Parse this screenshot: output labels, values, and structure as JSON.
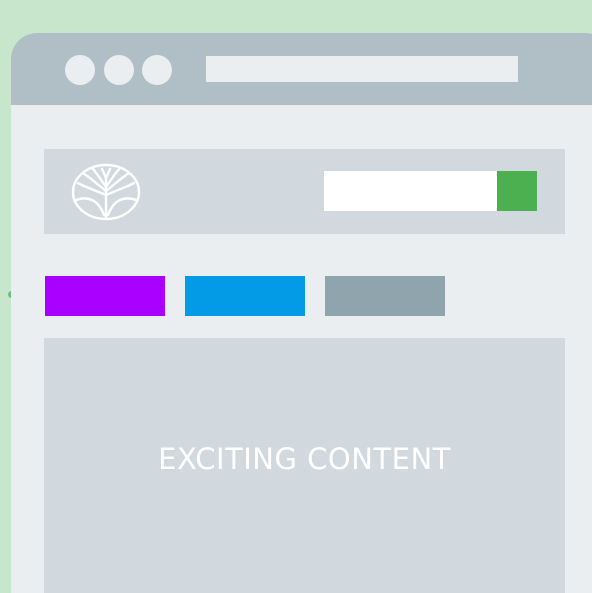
{
  "titlebar": {
    "controls": [
      "window-control",
      "window-control",
      "window-control"
    ]
  },
  "address_bar": {
    "value": ""
  },
  "header": {
    "logo_icon": "tree-logo-icon",
    "search": {
      "value": "",
      "button_label": ""
    }
  },
  "nav": {
    "buttons": [
      {
        "label": "",
        "color": "#aa00ff"
      },
      {
        "label": "",
        "color": "#039be5"
      },
      {
        "label": "",
        "color": "#90a4ae"
      }
    ]
  },
  "main": {
    "content_text": "EXCITING CONTENT"
  },
  "colors": {
    "background": "#c8e6cc",
    "titlebar": "#b0bfc6",
    "window": "#eaeef1",
    "panel": "#d1d9de",
    "search_button": "#4caf50",
    "pager_dot": "#6cc07a"
  }
}
